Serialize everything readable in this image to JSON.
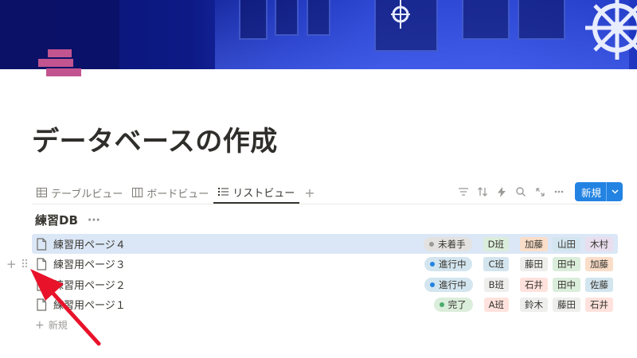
{
  "page": {
    "title": "データベースの作成",
    "cover_colors": [
      "#0a1470",
      "#2a44cf",
      "#1f36bf"
    ],
    "icon_color": "#c2548f"
  },
  "views": {
    "tabs": [
      {
        "label": "テーブルビュー",
        "icon": "table-icon",
        "active": false
      },
      {
        "label": "ボードビュー",
        "icon": "board-icon",
        "active": false
      },
      {
        "label": "リストビュー",
        "icon": "list-icon",
        "active": true
      }
    ],
    "add_view": "+"
  },
  "toolbar": {
    "icons": [
      "filter-icon",
      "sort-icon",
      "automation-icon",
      "search-icon",
      "expand-icon",
      "more-icon"
    ],
    "new_label": "新規",
    "accent": "#2383e2"
  },
  "database": {
    "title": "練習DB",
    "more": "···",
    "rows": [
      {
        "name": "練習用ページ４",
        "status": "未着手",
        "status_color": "#9b9a97",
        "status_bg": "#e3e2e0",
        "team": "D班",
        "team_bg": "#dbeddb",
        "members": [
          {
            "n": "加藤",
            "bg": "#fadec9"
          },
          {
            "n": "山田",
            "bg": "#d3e5ef"
          },
          {
            "n": "木村",
            "bg": "#e8deee"
          }
        ]
      },
      {
        "name": "練習用ページ３",
        "status": "進行中",
        "status_color": "#2383e2",
        "status_bg": "#d3e5ef",
        "team": "C班",
        "team_bg": "#d3e5ef",
        "members": [
          {
            "n": "藤田",
            "bg": "#eeeeed"
          },
          {
            "n": "田中",
            "bg": "#dbeddb"
          },
          {
            "n": "加藤",
            "bg": "#fadec9"
          }
        ]
      },
      {
        "name": "練習用ページ２",
        "status": "進行中",
        "status_color": "#2383e2",
        "status_bg": "#d3e5ef",
        "team": "B班",
        "team_bg": "#eeeeed",
        "members": [
          {
            "n": "石井",
            "bg": "#ffe2dd"
          },
          {
            "n": "田中",
            "bg": "#dbeddb"
          },
          {
            "n": "佐藤",
            "bg": "#d3e5ef"
          }
        ]
      },
      {
        "name": "練習用ページ１",
        "status": "完了",
        "status_color": "#4dab6f",
        "status_bg": "#dbeddb",
        "team": "A班",
        "team_bg": "#ffe2dd",
        "members": [
          {
            "n": "鈴木",
            "bg": "#eeeeed"
          },
          {
            "n": "藤田",
            "bg": "#eeeeed"
          },
          {
            "n": "石井",
            "bg": "#ffe2dd"
          }
        ]
      }
    ],
    "new_row_label": "新規"
  },
  "annotation": {
    "arrow_color": "#e8132a"
  }
}
